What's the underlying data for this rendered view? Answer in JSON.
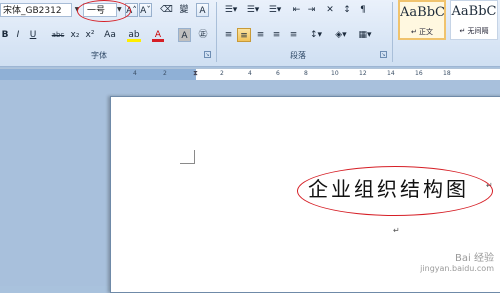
{
  "ribbon": {
    "font": {
      "name": "宋体_GB2312",
      "size": "一号",
      "grow_label": "A˄",
      "shrink_label": "Aˇ",
      "clear_format_label": "⌫",
      "phonetic_label": "變",
      "border_label": "A",
      "bold": "B",
      "italic": "I",
      "underline": "U",
      "strikethrough": "abc",
      "subscript": "x₂",
      "superscript": "x²",
      "change_case": "Aa",
      "highlight": "ab",
      "font_color": "A",
      "shading": "A",
      "enclose": "㊣",
      "group_label": "字体"
    },
    "paragraph": {
      "group_label": "段落"
    },
    "styles": {
      "items": [
        {
          "preview": "AaBbC",
          "label": "正文"
        },
        {
          "preview": "AaBbC",
          "label": "无间隔"
        }
      ]
    }
  },
  "ruler": {
    "numbers": [
      "4",
      "2",
      "2",
      "4",
      "6",
      "8",
      "10",
      "12",
      "14",
      "16",
      "18"
    ]
  },
  "document": {
    "title": "企业组织结构图",
    "para_mark": "↵"
  },
  "watermark": {
    "line1": "Bai 经验",
    "line2": "jingyan.baidu.com"
  },
  "colors": {
    "ribbon_bg": "#dce8f6",
    "page_bg": "#ffffff",
    "workspace_bg": "#a8c0dc",
    "annotation": "#d61f26"
  }
}
